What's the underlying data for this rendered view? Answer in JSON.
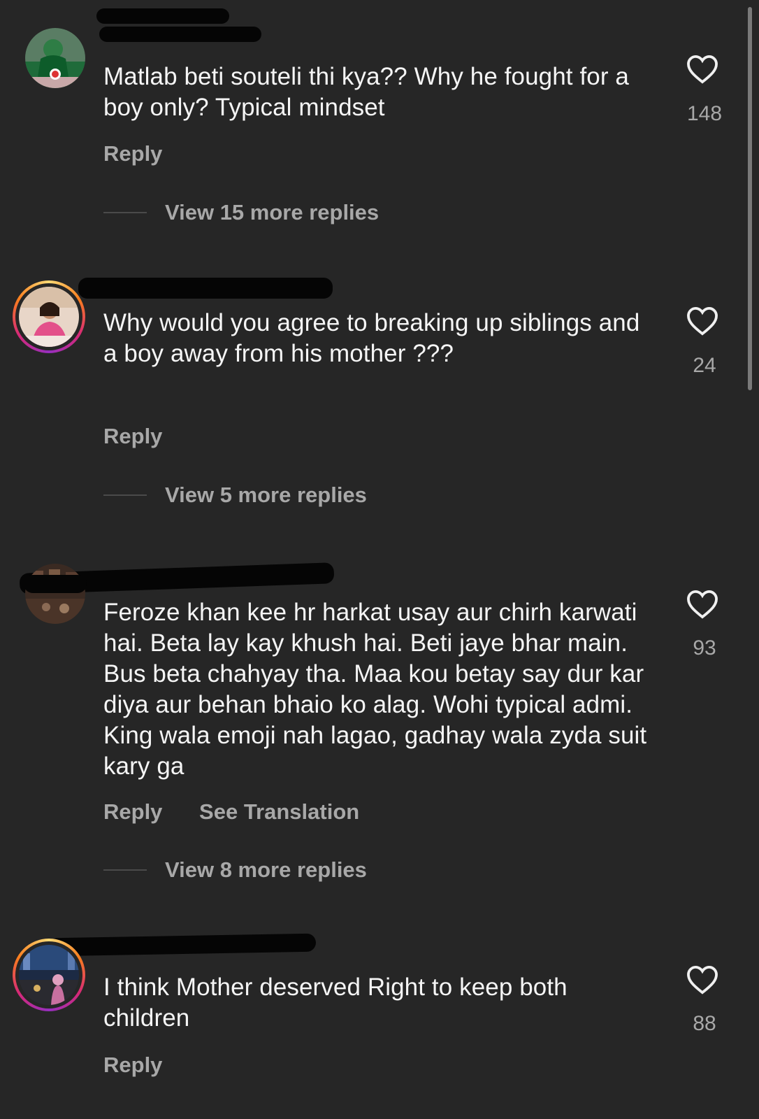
{
  "comments": [
    {
      "text": "Matlab beti souteli thi kya?? Why he fought for a boy only? Typical mindset",
      "likes": "148",
      "actions": [
        "Reply"
      ],
      "more_replies": "View 15 more replies"
    },
    {
      "text": "Why would you agree to breaking up siblings and a boy away from his mother ???",
      "likes": "24",
      "actions": [
        "Reply"
      ],
      "more_replies": "View 5 more replies"
    },
    {
      "text": "Feroze khan kee hr harkat usay aur chirh karwati hai. Beta lay kay khush hai. Beti jaye bhar main. Bus beta chahyay tha. Maa kou betay say dur kar diya aur behan bhaio ko alag. Wohi typical admi. King wala emoji nah lagao, gadhay wala zyda suit kary ga",
      "likes": "93",
      "actions": [
        "Reply",
        "See Translation"
      ],
      "more_replies": "View 8 more replies"
    },
    {
      "text": "I think Mother deserved Right to keep both children",
      "likes": "88",
      "actions": [
        "Reply"
      ],
      "more_replies": ""
    }
  ],
  "colors": {
    "background": "#262626",
    "text": "#f5f5f5",
    "secondary": "#a8a8a8",
    "redaction": "#050505"
  },
  "icons": {
    "like": "heart-outline-icon"
  }
}
